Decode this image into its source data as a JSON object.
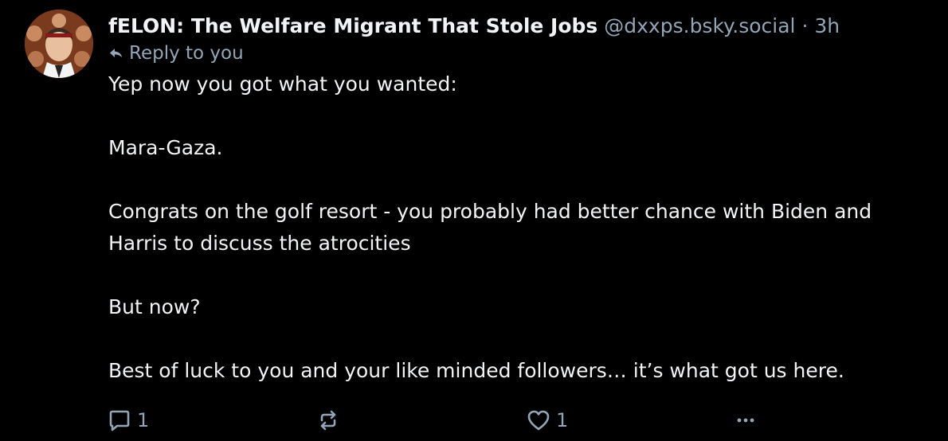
{
  "post": {
    "author_name": "fELON: The Welfare Migrant That Stole Jobs",
    "author_handle": "@dxxps.bsky.social",
    "separator": "·",
    "time": "3h",
    "reply_context": "Reply to you",
    "paragraphs": [
      "Yep now you got what you wanted:",
      "Mara-Gaza.",
      "Congrats on the golf resort - you probably had better chance with Biden and Harris to discuss the atrocities",
      "But now?",
      "Best of luck to you and your like minded followers… it’s what got us here."
    ],
    "reply_count": "1",
    "like_count": "1"
  },
  "colors": {
    "background": "#000000",
    "text": "#f1f3f5",
    "muted": "#93a5b7"
  },
  "icons": {
    "reply": "speech-bubble-icon",
    "repost": "repost-arrows-icon",
    "like": "heart-icon",
    "more": "ellipsis-icon",
    "reply_context": "reply-arrow-icon"
  }
}
